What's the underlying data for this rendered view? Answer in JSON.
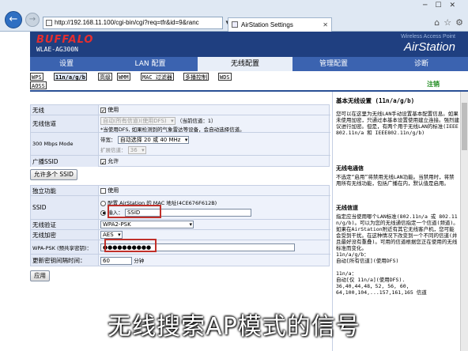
{
  "browser": {
    "url": "http://192.168.11.100/cgi-bin/cgi?req=tfr&id=9&ranc",
    "tab_title": "AirStation Settings",
    "url_tools": "▾ ⟳"
  },
  "header": {
    "logo": "BUFFALO",
    "model": "WLAE-AG300N",
    "subtitle": "Wireless Access Point",
    "brand": "AirStation"
  },
  "main_nav": [
    "设置",
    "LAN 配置",
    "无线配置",
    "管理配置",
    "诊断"
  ],
  "sub_nav": [
    "WPS",
    "11n/a/g/b",
    "高级",
    "WMM",
    "MAC 过滤器",
    "多播控制",
    "WDS",
    "AOSS"
  ],
  "logout_link": "注销",
  "form": {
    "wireless": {
      "label": "无线",
      "checkbox_text": "使用"
    },
    "channel": {
      "label": "无线信道",
      "select_value": "自动(所有信道)(使用DFS)",
      "current": "（当前信道：1）",
      "hint": "*当使用DFS, 如果检测到的气象雷达等设备，会自动选择信道。"
    },
    "mode300": {
      "label": "300 Mbps Mode",
      "bandwidth_label": "带宽：",
      "bandwidth_value": "自动选择 20 或 40 MHz",
      "ext_label": "扩展信道：",
      "ext_value": "36"
    },
    "broadcast": {
      "label": "广播SSID",
      "checkbox_text": "允许"
    },
    "multi_ssid_button": "允许多个 SSID",
    "independent": {
      "label": "独立功能",
      "checkbox_text": "使用"
    },
    "ssid": {
      "label": "SSID",
      "opt1": "配置 AirStation 的 MAC 地址(4CE676F612B)",
      "opt2_label": "输入：",
      "opt2_value": "SSID"
    },
    "auth": {
      "label": "无线验证",
      "value": "WPA2-PSK"
    },
    "encryption": {
      "label": "无线加密",
      "value": "AES"
    },
    "psk": {
      "label": "WPA-PSK (预共享密钥)：",
      "value": "●●●●●●●●●●"
    },
    "rekey": {
      "label": "更新密钥间隔时间：",
      "value": "60",
      "unit": "分钟"
    },
    "apply_button": "应用"
  },
  "help": {
    "title": "基本无线设置 (11n/a/g/b)",
    "intro": "您可以在这里为无线LAN手动设置基本配置信息。如果未使用加密，只通过本基本设置使用建立连接。强烈建议进行加密。但是，有两个用于无线LAN的标准(IEEE802.11n/a 和 IEEE802.11n/g/b)",
    "sec1_title": "无线电通信",
    "sec1_body": "不选定“启用”将禁用无线LAN功能。当禁用时，将禁用所有无线功能，包括广播在内，默认值是启用。",
    "sec2_title": "无线信道",
    "sec2_body": "指定应当使用哪个LAN标准(802.11n/a 或 802.11n/g/b)。可以为您的无线通信指定一个信道(频道)。如果在AirStation附近有其它无线客户机，您可能会受到干扰。在这种情况下改变到一个不同的信道(并且最好没有重叠)。可用的信道根据您正在使用的无线标准而变化。\n11n/a/g/b：\n自动[所有信道](使用DFS)\n\n11n/a：\n自动[仅 11n/a](使用DFS).\n36,40,44,48，52, 56, 60,\n64,100,104,...157,161,165 信道"
  },
  "caption": "无线搜索AP模式的信号"
}
